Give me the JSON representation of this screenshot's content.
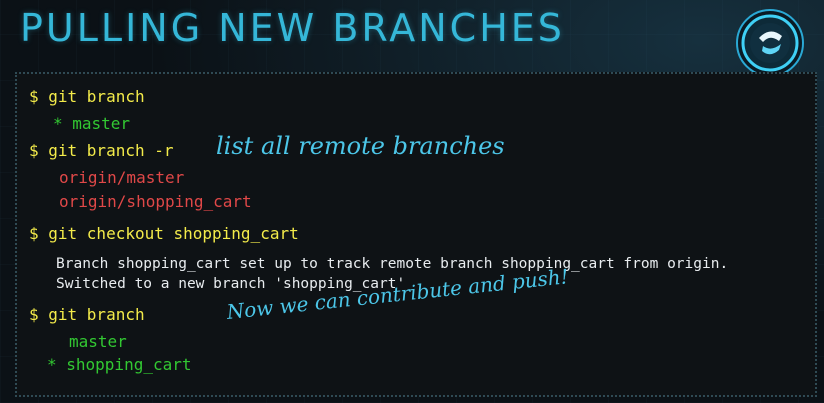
{
  "slide": {
    "title": "PULLING NEW BRANCHES"
  },
  "terminal": {
    "cmd1": "$ git branch",
    "out1": "* master",
    "cmd2": "$ git branch -r",
    "remote1": "origin/master",
    "remote2": "origin/shopping_cart",
    "cmd3": "$ git checkout shopping_cart",
    "msg1": "Branch shopping_cart set up to track remote branch shopping_cart from origin.",
    "msg2": "Switched to a new branch 'shopping_cart'",
    "cmd4": "$ git branch",
    "branch_master": "master",
    "branch_current": "* shopping_cart"
  },
  "annotations": {
    "note1": "list all remote branches",
    "note2": "Now we can contribute and push!"
  },
  "colors": {
    "title": "#35b7d8",
    "command": "#f3eb4a",
    "branch": "#32c832",
    "remote": "#e04848",
    "note": "#4cc6e8"
  },
  "icons": {
    "logo": "codeschool-logo-icon"
  }
}
